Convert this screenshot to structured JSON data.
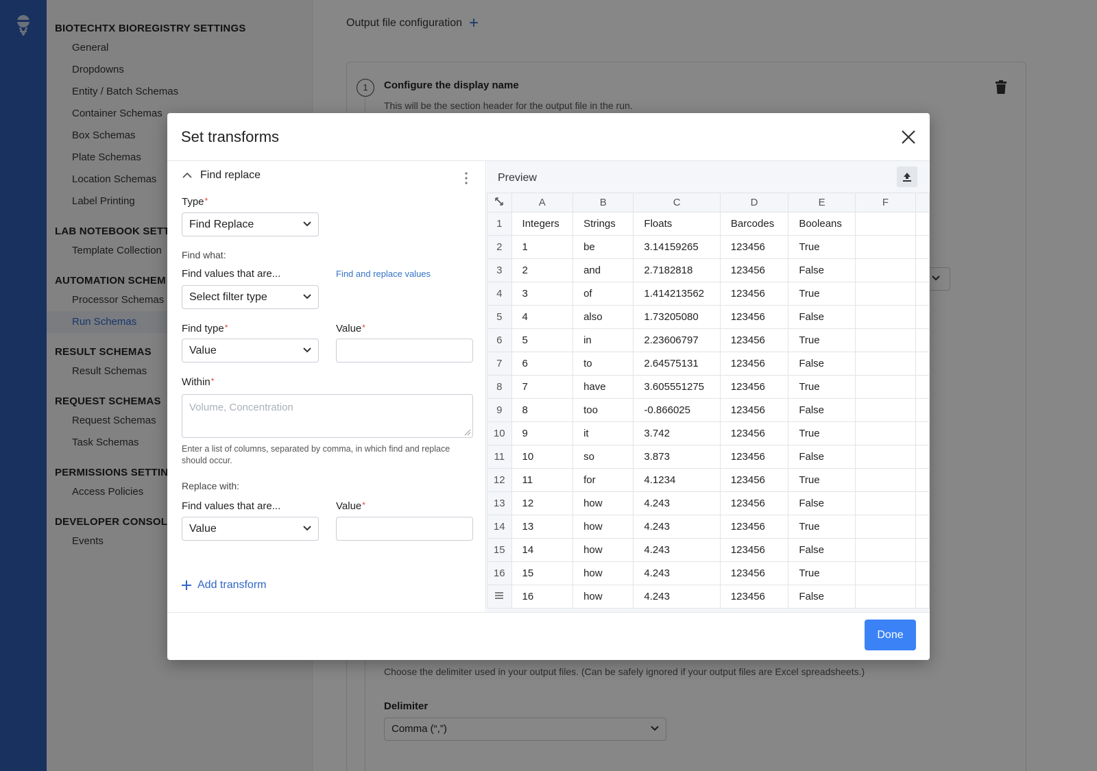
{
  "nav": {
    "sections": [
      {
        "title": "BIOTECHTX BIOREGISTRY SETTINGS",
        "items": [
          "General",
          "Dropdowns",
          "Entity / Batch Schemas",
          "Container Schemas",
          "Box Schemas",
          "Plate Schemas",
          "Location Schemas",
          "Label Printing"
        ]
      },
      {
        "title": "LAB NOTEBOOK SETT",
        "items": [
          "Template Collection"
        ]
      },
      {
        "title": "AUTOMATION SCHEM",
        "items": [
          "Processor Schemas",
          "Run Schemas"
        ]
      },
      {
        "title": "RESULT SCHEMAS",
        "items": [
          "Result Schemas"
        ]
      },
      {
        "title": "REQUEST SCHEMAS",
        "items": [
          "Request Schemas",
          "Task Schemas"
        ]
      },
      {
        "title": "PERMISSIONS SETTIN",
        "items": [
          "Access Policies"
        ]
      },
      {
        "title": "DEVELOPER CONSOL",
        "items": [
          "Events"
        ]
      }
    ],
    "active_item": "Run Schemas"
  },
  "background": {
    "output_config_label": "Output file configuration",
    "step_number": "1",
    "step_title": "Configure the display name",
    "step_subtitle": "This will be the section header for the output file in the run.",
    "delimiter_description": "Choose the delimiter used in your output files. (Can be safely ignored if your output files are Excel spreadsheets.)",
    "delimiter_label": "Delimiter",
    "delimiter_value": "Comma (“,”)"
  },
  "modal": {
    "title": "Set transforms",
    "done_label": "Done",
    "transform": {
      "name": "Find replace",
      "type_label": "Type",
      "type_value": "Find Replace",
      "type_hint": "Find and replace values",
      "find_what_label": "Find what:",
      "find_values_label": "Find values that are...",
      "filter_type_value": "Select filter type",
      "find_type_label": "Find type",
      "find_type_value": "Value",
      "value_label": "Value",
      "within_label": "Within",
      "within_placeholder": "Volume, Concentration",
      "within_hint": "Enter a list of columns, separated by comma, in which find and replace should occur.",
      "replace_with_label": "Replace with:",
      "replace_find_values_label": "Find values that are...",
      "replace_type_value": "Value",
      "replace_value_label": "Value"
    },
    "add_transform_label": "Add transform",
    "preview": {
      "label": "Preview",
      "columns": [
        "A",
        "B",
        "C",
        "D",
        "E",
        "F"
      ],
      "row_numbers": [
        "1",
        "2",
        "3",
        "4",
        "5",
        "6",
        "7",
        "8",
        "9",
        "10",
        "11",
        "12",
        "13",
        "14",
        "15",
        "16"
      ],
      "rows": [
        [
          "Integers",
          "Strings",
          "Floats",
          "Barcodes",
          "Booleans",
          ""
        ],
        [
          "1",
          "be",
          "3.14159265",
          "123456",
          "True",
          ""
        ],
        [
          "2",
          "and",
          "2.7182818",
          "123456",
          "False",
          ""
        ],
        [
          "3",
          "of",
          "1.414213562",
          "123456",
          "True",
          ""
        ],
        [
          "4",
          "also",
          "1.73205080",
          "123456",
          "False",
          ""
        ],
        [
          "5",
          "in",
          "2.23606797",
          "123456",
          "True",
          ""
        ],
        [
          "6",
          "to",
          "2.64575131",
          "123456",
          "False",
          ""
        ],
        [
          "7",
          "have",
          "3.605551275",
          "123456",
          "True",
          ""
        ],
        [
          "8",
          "too",
          "-0.866025",
          "123456",
          "False",
          ""
        ],
        [
          "9",
          "it",
          "3.742",
          "123456",
          "True",
          ""
        ],
        [
          "10",
          "so",
          "3.873",
          "123456",
          "False",
          ""
        ],
        [
          "11",
          "for",
          "4.1234",
          "123456",
          "True",
          ""
        ],
        [
          "12",
          "how",
          "4.243",
          "123456",
          "False",
          ""
        ],
        [
          "13",
          "how",
          "4.243",
          "123456",
          "True",
          ""
        ],
        [
          "14",
          "how",
          "4.243",
          "123456",
          "False",
          ""
        ],
        [
          "15",
          "how",
          "4.243",
          "123456",
          "True",
          ""
        ],
        [
          "16",
          "how",
          "4.243",
          "123456",
          "False",
          ""
        ]
      ]
    }
  },
  "colors": {
    "rail": "#2f5eb3",
    "accent": "#3b82f6",
    "link": "#2f66c7",
    "required": "#e0443c"
  }
}
